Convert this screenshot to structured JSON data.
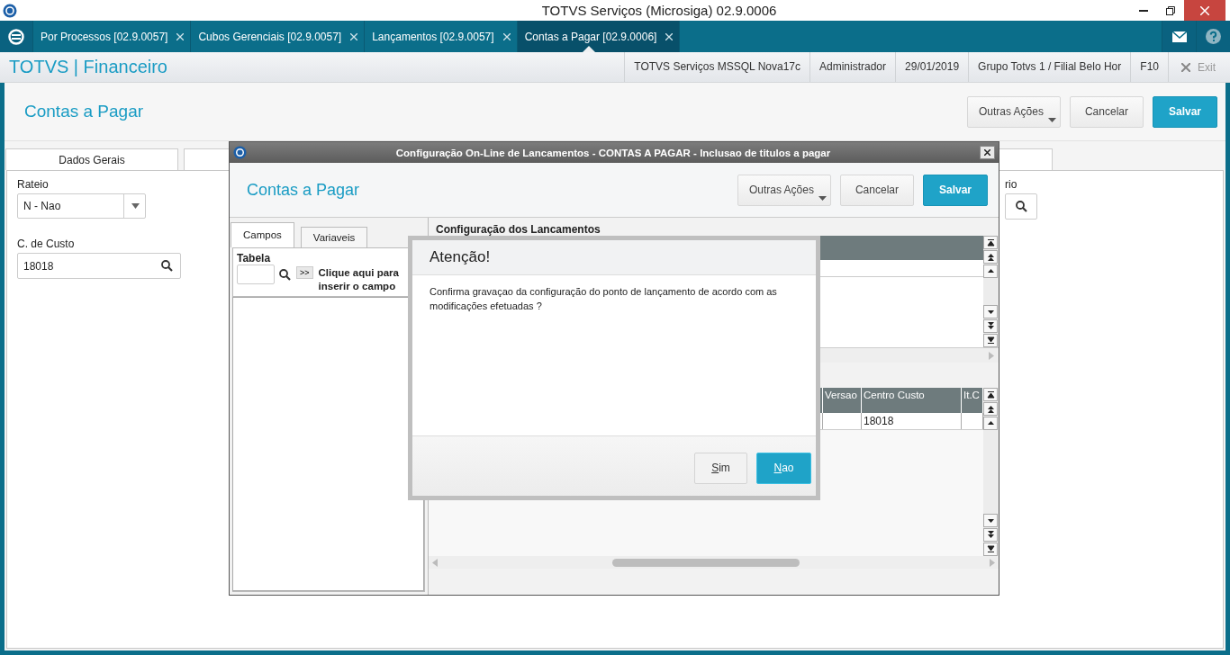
{
  "window": {
    "title": "TOTVS Serviços (Microsiga) 02.9.0006"
  },
  "tabs": [
    {
      "label": "Por Processos [02.9.0057]",
      "selected": false
    },
    {
      "label": "Cubos Gerenciais [02.9.0057]",
      "selected": false
    },
    {
      "label": "Lançamentos [02.9.0057]",
      "selected": false
    },
    {
      "label": "Contas a Pagar [02.9.0006]",
      "selected": true
    }
  ],
  "app_header": {
    "brand": "TOTVS | Financeiro",
    "info": [
      "TOTVS Serviços MSSQL Nova17c",
      "Administrador",
      "29/01/2019",
      "Grupo Totvs 1 / Filial Belo Hor",
      "F10"
    ],
    "exit": "Exit"
  },
  "page": {
    "title": "Contas a Pagar",
    "buttons": [
      {
        "label": "Outras Ações",
        "kind": "menu"
      },
      {
        "label": "Cancelar",
        "kind": "default"
      },
      {
        "label": "Salvar",
        "kind": "primary"
      }
    ]
  },
  "form_tabs": [
    {
      "label": "Dados Gerais",
      "selected": true
    }
  ],
  "form": {
    "rateio_label": "Rateio",
    "rateio_value": "N - Nao",
    "custo_label": "C. de Custo",
    "custo_value": "18018",
    "cut_label": "rio"
  },
  "config_window": {
    "title": "Configuração On-Line de Lancamentos - CONTAS A PAGAR - Inclusao de titulos a pagar",
    "heading": "Contas a Pagar",
    "buttons": [
      {
        "label": "Outras Ações",
        "kind": "menu"
      },
      {
        "label": "Cancelar",
        "kind": "default"
      },
      {
        "label": "Salvar",
        "kind": "primary"
      }
    ],
    "side_tabs": [
      {
        "label": "Campos",
        "selected": true
      },
      {
        "label": "Variaveis",
        "selected": false
      }
    ],
    "tabela_label": "Tabela",
    "insert_button": ">>",
    "insert_hint": "Clique aqui para inserir o campo",
    "section_title": "Configuração dos Lancamentos",
    "grid_columns": [
      "Versao",
      "Centro Custo",
      "It.C"
    ],
    "grid_row": {
      "centro_custo": "18018"
    }
  },
  "dialog": {
    "title": "Atenção!",
    "message": "Confirma gravaçao da configuração do ponto de lançamento de acordo com as modificações efetuadas ?",
    "buttons": [
      {
        "label": "Sim",
        "kind": "default"
      },
      {
        "label": "Nao",
        "kind": "primary"
      }
    ]
  }
}
